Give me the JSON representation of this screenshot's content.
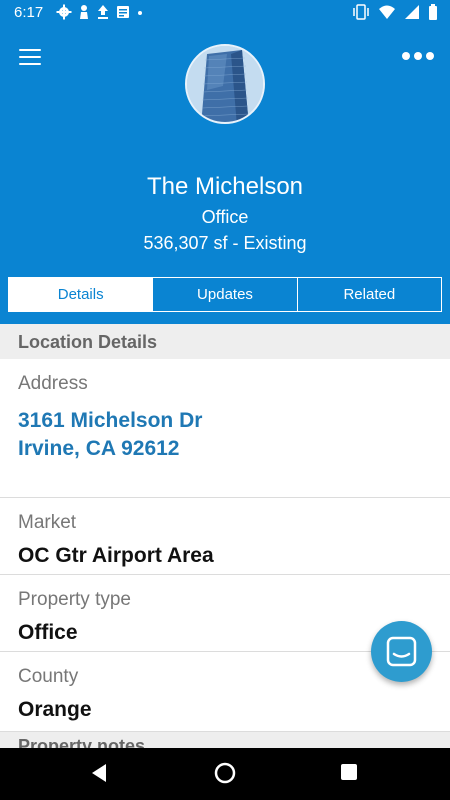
{
  "status_bar": {
    "time": "6:17"
  },
  "header": {
    "title": "The Michelson",
    "subtitle": "Office",
    "size_line": "536,307 sf - Existing"
  },
  "tabs": [
    {
      "label": "Details"
    },
    {
      "label": "Updates"
    },
    {
      "label": "Related"
    }
  ],
  "section_location": {
    "title": "Location Details"
  },
  "address": {
    "label": "Address",
    "line1": "3161 Michelson Dr",
    "line2": "Irvine, CA 92612"
  },
  "market": {
    "label": "Market",
    "value": "OC Gtr Airport Area"
  },
  "property_type": {
    "label": "Property type",
    "value": "Office"
  },
  "county": {
    "label": "County",
    "value": "Orange"
  },
  "section_notes": {
    "title": "Property notes"
  },
  "colors": {
    "brand": "#0a84d2",
    "link": "#1f78b4",
    "fab": "#2e9ccf"
  }
}
